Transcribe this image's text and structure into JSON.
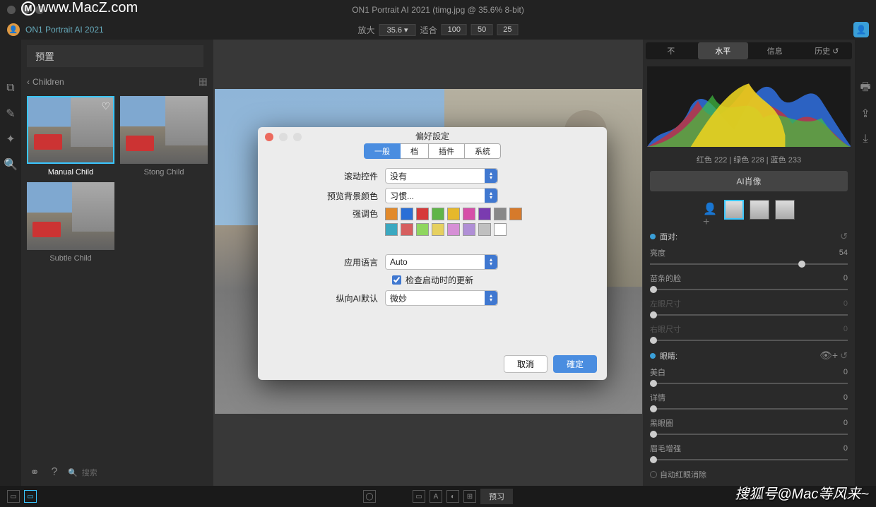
{
  "window": {
    "title": "ON1 Portrait AI 2021 (timg.jpg @ 35.6% 8-bit)"
  },
  "watermark": {
    "text": "www.MacZ.com",
    "logo": "M"
  },
  "subheader": {
    "app_name": "ON1 Portrait AI 2021"
  },
  "zoom": {
    "label": "放大",
    "value": "35.6 ▾",
    "fit": "适合",
    "p100": "100",
    "p50": "50",
    "p25": "25"
  },
  "left": {
    "preset_label": "预置",
    "breadcrumb": "Children",
    "thumbs": [
      {
        "label": "Manual Child",
        "selected": true
      },
      {
        "label": "Stong Child",
        "selected": false
      },
      {
        "label": "Subtle Child",
        "selected": false
      }
    ],
    "search_placeholder": "搜索"
  },
  "right": {
    "tabs": {
      "t1": "不",
      "t2": "水平",
      "t3": "信息",
      "t4": "历史 ↺"
    },
    "histo_info": "红色 222 | 绿色 228 | 蓝色 233",
    "ai_button": "AI肖像",
    "section_face": "面对:",
    "brightness": {
      "label": "亮度",
      "value": "54"
    },
    "slim": {
      "label": "苗条的脸",
      "value": "0"
    },
    "left_eye": {
      "label": "左眼尺寸",
      "value": "0"
    },
    "right_eye": {
      "label": "右眼尺寸",
      "value": "0"
    },
    "section_eyes": "眼睛:",
    "whiten": {
      "label": "美白",
      "value": "0"
    },
    "detail": {
      "label": "详情",
      "value": "0"
    },
    "dark_circle": {
      "label": "黑眼圈",
      "value": "0"
    },
    "brow": {
      "label": "眉毛增强",
      "value": "0"
    },
    "auto_redeye": "自动红眼消除"
  },
  "bottom": {
    "preview": "预习"
  },
  "dialog": {
    "title": "偏好設定",
    "tabs": {
      "general": "一般",
      "files": "档",
      "plugins": "插件",
      "system": "系統"
    },
    "scroll": {
      "label": "滚动控件",
      "value": "没有"
    },
    "bg": {
      "label": "预览背景颜色",
      "value": "习惯..."
    },
    "accent_label": "强调色",
    "swatches": [
      "#e28a2b",
      "#2b6fd6",
      "#d63b3b",
      "#5fb548",
      "#e6b82b",
      "#d64fa8",
      "#7a3bb0",
      "#888888",
      "#d67a2b",
      "#3ba8c0",
      "#d65f5f",
      "#8fd65f",
      "#e6d05f",
      "#d68fd6",
      "#b08fd6",
      "#c0c0c0",
      "#ffffff"
    ],
    "lang": {
      "label": "应用语言",
      "value": "Auto"
    },
    "check_updates": "检查启动时的更新",
    "ai_default": {
      "label": "纵向AI默认",
      "value": "微妙"
    },
    "cancel": "取消",
    "ok": "確定"
  },
  "sohu": "搜狐号@Mac等风来~"
}
